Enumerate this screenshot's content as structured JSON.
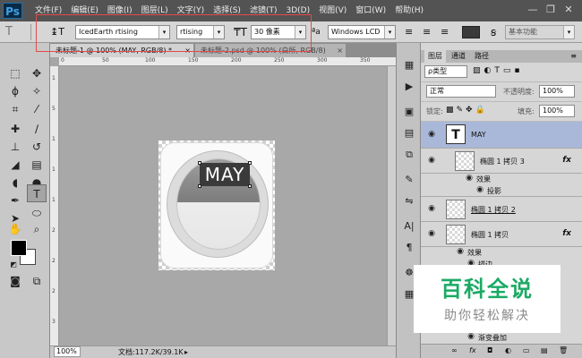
{
  "app": {
    "logo": "Ps"
  },
  "menu": [
    "文件(F)",
    "编辑(E)",
    "图像(I)",
    "图层(L)",
    "文字(Y)",
    "选择(S)",
    "滤镜(T)",
    "3D(D)",
    "视图(V)",
    "窗口(W)",
    "帮助(H)"
  ],
  "window_controls": {
    "minimize": "—",
    "restore": "❐",
    "close": "✕"
  },
  "options": {
    "font_family": "IcedEarth rtising",
    "font_style": "rtising",
    "font_size": "30 像素",
    "aa_label": "ªa",
    "antialias": "Windows LCD",
    "workspace": "基本功能"
  },
  "tabs": [
    {
      "label": "未标题-1 @ 100% (MAY, RGB/8) *",
      "close": "×"
    },
    {
      "label": "未标题-2.psd @ 100% (白所, RGB/8)",
      "close": "×"
    }
  ],
  "ruler_top": [
    "0",
    "50",
    "100",
    "150",
    "200",
    "250",
    "300",
    "350"
  ],
  "ruler_left": [
    "1",
    "5",
    "1",
    "1",
    "1",
    "2",
    "2",
    "2",
    "3"
  ],
  "canvas": {
    "text": "MAY"
  },
  "status": {
    "zoom": "100%",
    "doc_info": "文档:117.2K/39.1K"
  },
  "panel": {
    "tabs": [
      "图层",
      "通道",
      "路径"
    ],
    "filter_kind": "ρ类型",
    "blend_mode": "正常",
    "opacity_label": "不透明度:",
    "opacity_value": "100%",
    "lock_label": "锁定:",
    "fill_label": "填充:",
    "fill_value": "100%",
    "layers": [
      {
        "name": "MAY",
        "type": "text"
      },
      {
        "name": "椭圆 1 拷贝 3",
        "fx": "fx"
      },
      {
        "name": "效果",
        "type": "effect"
      },
      {
        "name": "投影",
        "type": "effect-item"
      },
      {
        "name": "椭圆 1 拷贝 2"
      },
      {
        "name": "椭圆 1 拷贝",
        "fx": "fx"
      },
      {
        "name": "效果",
        "type": "effect"
      },
      {
        "name": "描边",
        "type": "effect-item"
      },
      {
        "name": "渐变叠加",
        "type": "effect-item"
      }
    ],
    "bottom_icons": [
      "∞",
      "fx",
      "◘",
      "◐",
      "▭",
      "▤",
      "🗑"
    ]
  },
  "watermark": {
    "main": "百科全说",
    "sub": "助你轻松解决"
  },
  "colors": {
    "highlight": "#e24a4a",
    "watermark": "#1aaa64",
    "selected_layer": "#a9b8d8"
  }
}
